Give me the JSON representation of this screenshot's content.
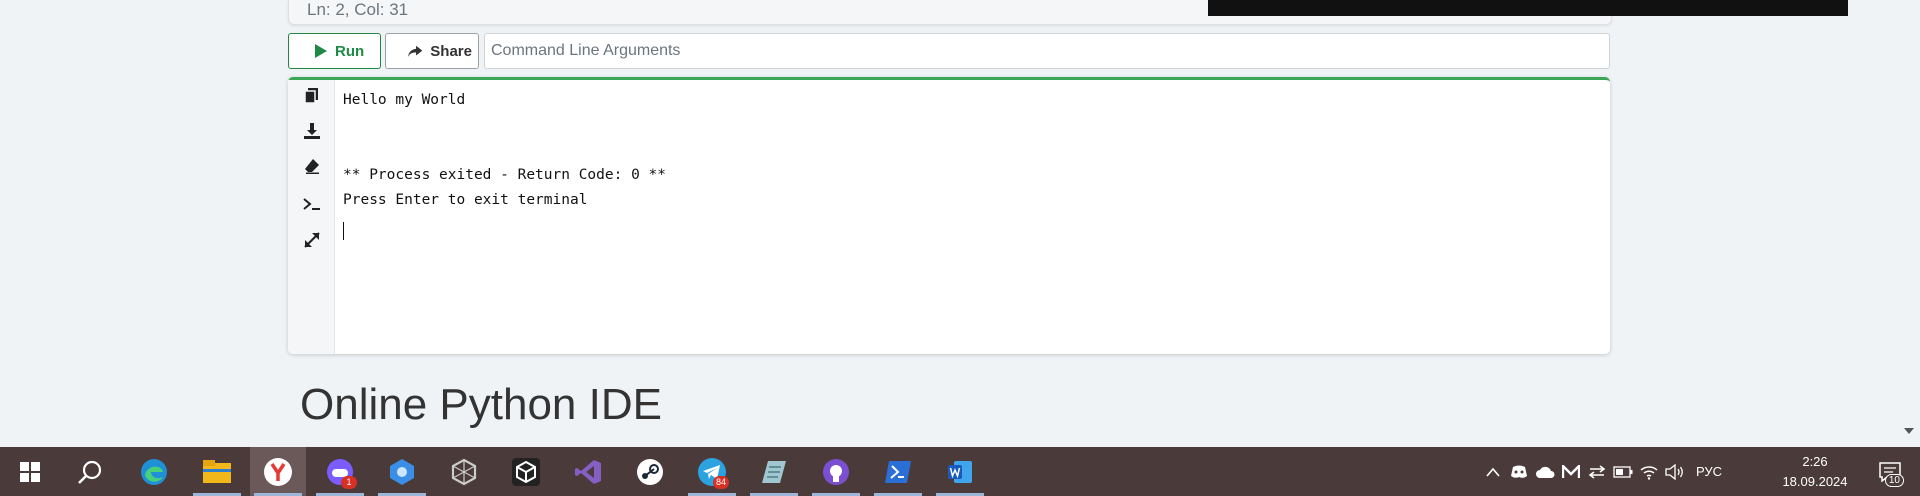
{
  "editor": {
    "status": "Ln: 2,  Col: 31"
  },
  "toolbar": {
    "run_label": "Run",
    "share_label": "Share",
    "args_placeholder": "Command Line Arguments"
  },
  "terminal": {
    "lines": [
      "Hello my World",
      "",
      "",
      "** Process exited - Return Code: 0 **",
      "Press Enter to exit terminal"
    ],
    "tools": [
      "copy-icon",
      "download-icon",
      "eraser-icon",
      "terminal-icon",
      "expand-icon"
    ]
  },
  "page": {
    "heading": "Online Python IDE"
  },
  "taskbar": {
    "apps": [
      {
        "name": "edge-icon"
      },
      {
        "name": "file-explorer-icon"
      },
      {
        "name": "yandex-browser-icon",
        "active": true
      },
      {
        "name": "game-launcher-icon",
        "badge": "1"
      },
      {
        "name": "blue-app-icon"
      },
      {
        "name": "hex-app-icon"
      },
      {
        "name": "unity-icon"
      },
      {
        "name": "visual-studio-icon"
      },
      {
        "name": "steam-icon"
      },
      {
        "name": "telegram-icon",
        "badge": "84"
      },
      {
        "name": "notes-app-icon"
      },
      {
        "name": "github-icon"
      },
      {
        "name": "powershell-icon"
      },
      {
        "name": "word-icon"
      }
    ],
    "language": "РУС",
    "time": "2:26",
    "date": "18.09.2024",
    "notifications": "10"
  },
  "colors": {
    "accent_green": "#1f8a46",
    "terminal_border": "#3aa757",
    "taskbar": "#4a3a3a"
  }
}
